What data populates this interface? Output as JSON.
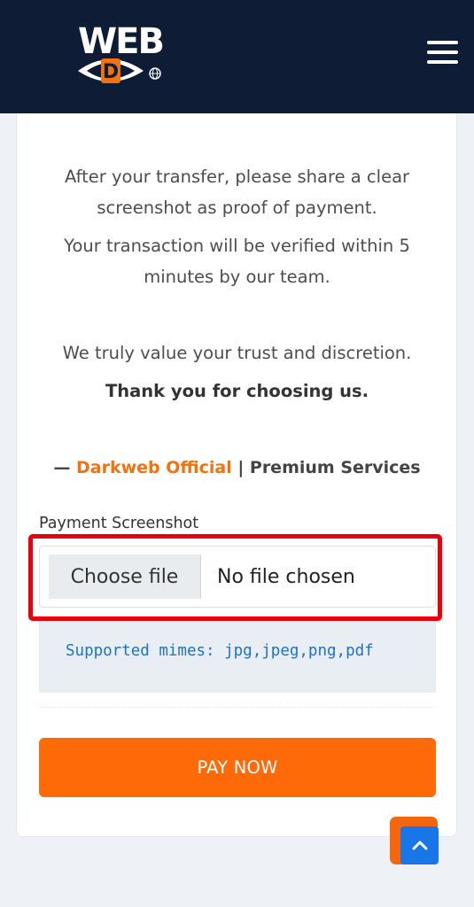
{
  "header": {
    "logo_text": "WEB",
    "logo_letter": "D",
    "logo_icon": "darkweb-eye-logo",
    "menu_icon": "hamburger-menu-icon"
  },
  "message": {
    "line1": "After your transfer, please share a clear",
    "line2": "screenshot as proof of payment.",
    "line3": "Your transaction will be verified within 5",
    "line4": "minutes by our team.",
    "line5": "We truly value your trust and discretion.",
    "thanks": "Thank you for choosing us."
  },
  "signature": {
    "dash": "— ",
    "brand": "Darkweb Official",
    "separator": " | ",
    "tagline": "Premium Services"
  },
  "upload": {
    "label": "Payment Screenshot",
    "button_label": "Choose file",
    "status": "No file chosen",
    "supported": "Supported mimes: jpg,jpeg,png,pdf"
  },
  "actions": {
    "pay_label": "PAY NOW",
    "scroll_top_icon": "chevron-up-icon"
  },
  "colors": {
    "header_bg": "#0f1c35",
    "accent_orange": "#ff6a08",
    "brand_orange": "#f27110",
    "highlight_red": "#e8000b",
    "link_blue": "#1976e8"
  }
}
